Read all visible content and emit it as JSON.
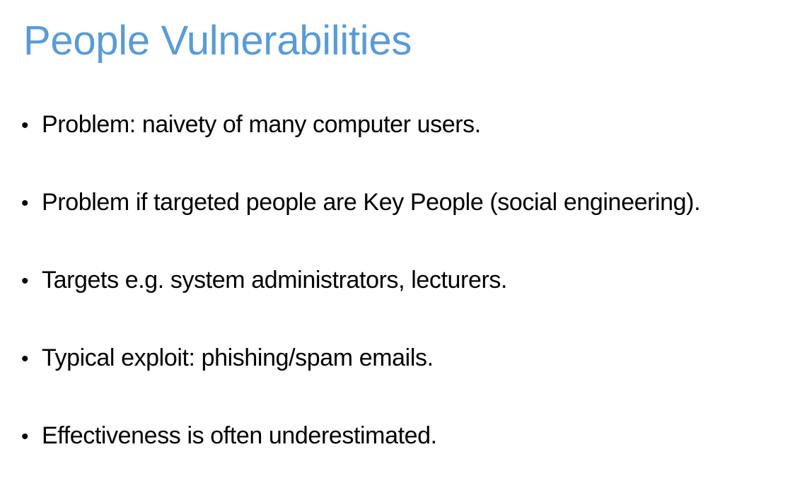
{
  "slide": {
    "title": "People Vulnerabilities",
    "title_color": "#5b9bd5",
    "bullet_glyph": "•",
    "bullets": [
      "Problem: naivety of many computer users.",
      "Problem if targeted people are Key People (social engineering).",
      "Targets e.g. system administrators, lecturers.",
      "Typical exploit: phishing/spam emails.",
      "Effectiveness is often underestimated."
    ]
  }
}
